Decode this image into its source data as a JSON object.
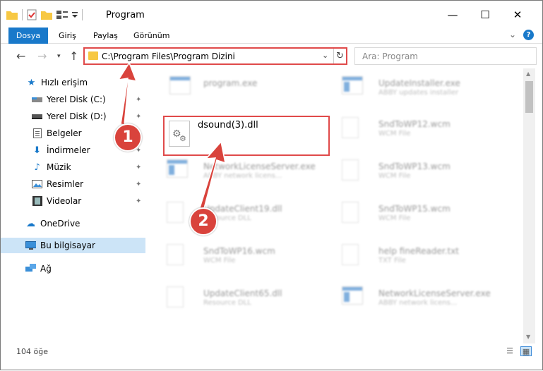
{
  "window": {
    "title": "Program",
    "minimize": "—",
    "maximize": "☐",
    "close": "✕"
  },
  "ribbon": {
    "tabs": [
      "Dosya",
      "Giriş",
      "Paylaş",
      "Görünüm"
    ],
    "expand": "⌄",
    "help": "?"
  },
  "nav": {
    "back": "←",
    "forward": "→",
    "recent": "▾",
    "up": "↑",
    "address": "C:\\Program Files\\Program Dizini",
    "address_dropdown": "⌄",
    "refresh": "↻",
    "search_placeholder": "Ara: Program"
  },
  "sidebar": {
    "items": [
      {
        "label": "Hızlı erişim",
        "icon": "star-icon"
      },
      {
        "label": "Yerel Disk (C:)",
        "icon": "drive-icon",
        "pinned": true
      },
      {
        "label": "Yerel Disk (D:)",
        "icon": "drive-icon",
        "pinned": true
      },
      {
        "label": "Belgeler",
        "icon": "documents-icon",
        "pinned": true
      },
      {
        "label": "İndirmeler",
        "icon": "download-icon",
        "pinned": true
      },
      {
        "label": "Müzik",
        "icon": "music-icon",
        "pinned": true
      },
      {
        "label": "Resimler",
        "icon": "pictures-icon",
        "pinned": true
      },
      {
        "label": "Videolar",
        "icon": "video-icon",
        "pinned": true
      },
      {
        "label": "OneDrive",
        "icon": "cloud-icon"
      },
      {
        "label": "Bu bilgisayar",
        "icon": "computer-icon",
        "selected": true
      },
      {
        "label": "Ağ",
        "icon": "network-icon"
      }
    ],
    "pin_glyph": "📌"
  },
  "files": {
    "highlighted": {
      "name": "dsound(3).dll"
    },
    "left_column": [
      {
        "name": "program.exe",
        "type": ""
      },
      {
        "name": "NetworkLicenseServer.exe",
        "type": "ABBY network licens..."
      },
      {
        "name": "UpdateClient19.dll",
        "type": "Resource DLL"
      },
      {
        "name": "SndToWP16.wcm",
        "type": "WCM File"
      },
      {
        "name": "UpdateClient65.dll",
        "type": "Resource DLL"
      }
    ],
    "right_column": [
      {
        "name": "UpdateInstaller.exe",
        "type": "ABBY updates installer"
      },
      {
        "name": "SndToWP12.wcm",
        "type": "WCM File"
      },
      {
        "name": "SndToWP13.wcm",
        "type": "WCM File"
      },
      {
        "name": "SndToWP15.wcm",
        "type": "WCM File"
      },
      {
        "name": "help fineReader.txt",
        "type": "TXT File"
      },
      {
        "name": "NetworkLicenseServer.exe",
        "type": "ABBY network licens..."
      }
    ]
  },
  "status": {
    "count": "104 öğe",
    "details_view": "☰",
    "icons_view": "▦"
  },
  "callouts": [
    "1",
    "2"
  ],
  "colors": {
    "accent": "#1979ca",
    "highlight_border": "#e04a4a",
    "callout": "#d9433c",
    "selected_bg": "#cce4f7"
  }
}
